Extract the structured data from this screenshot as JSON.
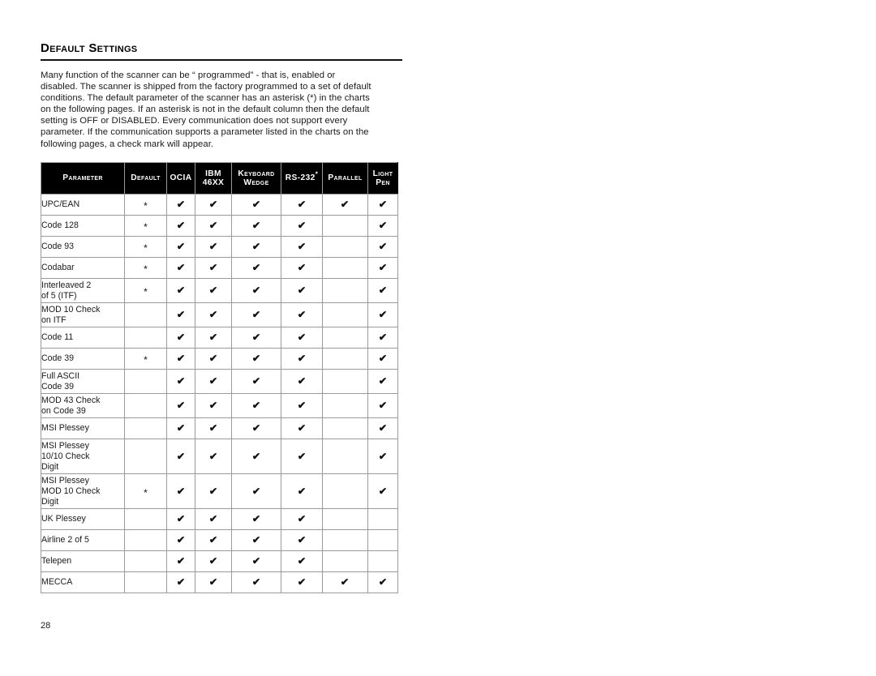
{
  "document": {
    "heading": "Default Settings",
    "intro": "Many function of the scanner can be “ programmed” - that is, enabled or\ndisabled.  The scanner is shipped from the factory programmed to a set of default\nconditions.  The default parameter of the scanner has an asterisk (*) in the charts\non the following pages.  If an asterisk is not in the default column then the default\nsetting is OFF or DISABLED.  Every communication does not support every\nparameter.  If the communication supports a parameter listed in the charts on the\nfollowing pages, a check mark will appear.",
    "page_number": "28"
  },
  "colors": {
    "header_background": "#000000",
    "header_text": "#ffffff",
    "body_text": "#1a1a1a",
    "grid_line": "#9a9a9a",
    "rule": "#111111"
  },
  "glyphs": {
    "check": "✔",
    "asterisk": "*"
  },
  "chart_data": {
    "type": "table",
    "title": "Default Settings",
    "columns": [
      {
        "key": "parameter",
        "label": "Parameter",
        "line2": "",
        "style": "small-caps"
      },
      {
        "key": "default",
        "label": "Default",
        "line2": "",
        "style": "small-caps"
      },
      {
        "key": "ocia",
        "label": "OCIA",
        "line2": "",
        "style": "all-caps"
      },
      {
        "key": "ibm46xx",
        "label": "IBM",
        "line2": "46XX",
        "style": "all-caps"
      },
      {
        "key": "keyboard_wedge",
        "label": "Keyboard",
        "line2": "Wedge",
        "style": "small-caps"
      },
      {
        "key": "rs232",
        "label": "RS-232",
        "line2": "",
        "superscript": "*",
        "style": "all-caps"
      },
      {
        "key": "parallel",
        "label": "Parallel",
        "line2": "",
        "style": "small-caps"
      },
      {
        "key": "light_pen",
        "label": "Light",
        "line2": "Pen",
        "style": "small-caps"
      }
    ],
    "rows": [
      {
        "parameter": "UPC/EAN",
        "lines": 1,
        "default": "*",
        "ocia": "✔",
        "ibm46xx": "✔",
        "keyboard_wedge": "✔",
        "rs232": "✔",
        "parallel": "✔",
        "light_pen": "✔"
      },
      {
        "parameter": "Code 128",
        "lines": 1,
        "default": "*",
        "ocia": "✔",
        "ibm46xx": "✔",
        "keyboard_wedge": "✔",
        "rs232": "✔",
        "parallel": "",
        "light_pen": "✔"
      },
      {
        "parameter": "Code 93",
        "lines": 1,
        "default": "*",
        "ocia": "✔",
        "ibm46xx": "✔",
        "keyboard_wedge": "✔",
        "rs232": "✔",
        "parallel": "",
        "light_pen": "✔"
      },
      {
        "parameter": "Codabar",
        "lines": 1,
        "default": "*",
        "ocia": "✔",
        "ibm46xx": "✔",
        "keyboard_wedge": "✔",
        "rs232": "✔",
        "parallel": "",
        "light_pen": "✔"
      },
      {
        "parameter": "Interleaved 2\nof 5 (ITF)",
        "lines": 2,
        "default": "*",
        "ocia": "✔",
        "ibm46xx": "✔",
        "keyboard_wedge": "✔",
        "rs232": "✔",
        "parallel": "",
        "light_pen": "✔"
      },
      {
        "parameter": "MOD 10 Check\non ITF",
        "lines": 2,
        "default": "",
        "ocia": "✔",
        "ibm46xx": "✔",
        "keyboard_wedge": "✔",
        "rs232": "✔",
        "parallel": "",
        "light_pen": "✔"
      },
      {
        "parameter": "Code 11",
        "lines": 1,
        "default": "",
        "ocia": "✔",
        "ibm46xx": "✔",
        "keyboard_wedge": "✔",
        "rs232": "✔",
        "parallel": "",
        "light_pen": "✔"
      },
      {
        "parameter": "Code 39",
        "lines": 1,
        "default": "*",
        "ocia": "✔",
        "ibm46xx": "✔",
        "keyboard_wedge": "✔",
        "rs232": "✔",
        "parallel": "",
        "light_pen": "✔"
      },
      {
        "parameter": "Full ASCII\nCode 39",
        "lines": 2,
        "default": "",
        "ocia": "✔",
        "ibm46xx": "✔",
        "keyboard_wedge": "✔",
        "rs232": "✔",
        "parallel": "",
        "light_pen": "✔"
      },
      {
        "parameter": "MOD 43 Check\non Code 39",
        "lines": 2,
        "default": "",
        "ocia": "✔",
        "ibm46xx": "✔",
        "keyboard_wedge": "✔",
        "rs232": "✔",
        "parallel": "",
        "light_pen": "✔"
      },
      {
        "parameter": "MSI Plessey",
        "lines": 1,
        "default": "",
        "ocia": "✔",
        "ibm46xx": "✔",
        "keyboard_wedge": "✔",
        "rs232": "✔",
        "parallel": "",
        "light_pen": "✔"
      },
      {
        "parameter": "MSI Plessey\n10/10 Check\nDigit",
        "lines": 3,
        "default": "",
        "ocia": "✔",
        "ibm46xx": "✔",
        "keyboard_wedge": "✔",
        "rs232": "✔",
        "parallel": "",
        "light_pen": "✔"
      },
      {
        "parameter": "MSI Plessey\nMOD 10 Check\nDigit",
        "lines": 3,
        "default": "*",
        "ocia": "✔",
        "ibm46xx": "✔",
        "keyboard_wedge": "✔",
        "rs232": "✔",
        "parallel": "",
        "light_pen": "✔"
      },
      {
        "parameter": "UK Plessey",
        "lines": 1,
        "default": "",
        "ocia": "✔",
        "ibm46xx": "✔",
        "keyboard_wedge": "✔",
        "rs232": "✔",
        "parallel": "",
        "light_pen": ""
      },
      {
        "parameter": "Airline 2 of 5",
        "lines": 1,
        "default": "",
        "ocia": "✔",
        "ibm46xx": "✔",
        "keyboard_wedge": "✔",
        "rs232": "✔",
        "parallel": "",
        "light_pen": ""
      },
      {
        "parameter": "Telepen",
        "lines": 1,
        "default": "",
        "ocia": "✔",
        "ibm46xx": "✔",
        "keyboard_wedge": "✔",
        "rs232": "✔",
        "parallel": "",
        "light_pen": ""
      },
      {
        "parameter": "MECCA",
        "lines": 1,
        "default": "",
        "ocia": "✔",
        "ibm46xx": "✔",
        "keyboard_wedge": "✔",
        "rs232": "✔",
        "parallel": "✔",
        "light_pen": "✔"
      }
    ]
  }
}
